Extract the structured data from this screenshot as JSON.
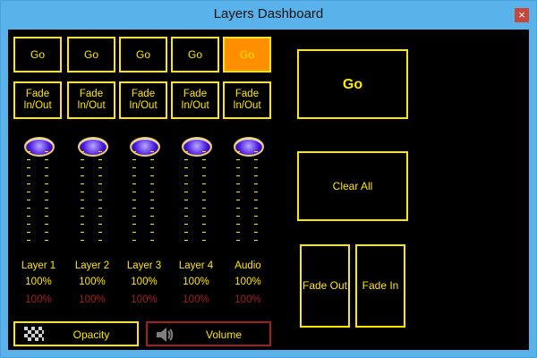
{
  "window": {
    "title": "Layers Dashboard",
    "close_glyph": "×"
  },
  "layers": [
    {
      "go": "Go",
      "fade": "Fade In/Out",
      "name": "Layer 1",
      "value": "100%",
      "sub_value": "100%",
      "active": false
    },
    {
      "go": "Go",
      "fade": "Fade In/Out",
      "name": "Layer 2",
      "value": "100%",
      "sub_value": "100%",
      "active": false
    },
    {
      "go": "Go",
      "fade": "Fade In/Out",
      "name": "Layer 3",
      "value": "100%",
      "sub_value": "100%",
      "active": false
    },
    {
      "go": "Go",
      "fade": "Fade In/Out",
      "name": "Layer 4",
      "value": "100%",
      "sub_value": "100%",
      "active": false
    },
    {
      "go": "Go",
      "fade": "Fade In/Out",
      "name": "Audio",
      "value": "100%",
      "sub_value": "100%",
      "active": true
    }
  ],
  "right_panel": {
    "go": "Go",
    "clear_all": "Clear All",
    "fade_out": "Fade Out",
    "fade_in": "Fade In"
  },
  "bottom": {
    "opacity": "Opacity",
    "volume": "Volume"
  },
  "icons": {
    "checker": "checkerboard-icon",
    "speaker": "speaker-icon",
    "knob": "slider-knob-icon"
  },
  "colors": {
    "accent": "#ffe800",
    "active_button": "#ff8e00",
    "muted_red": "#a32020"
  }
}
